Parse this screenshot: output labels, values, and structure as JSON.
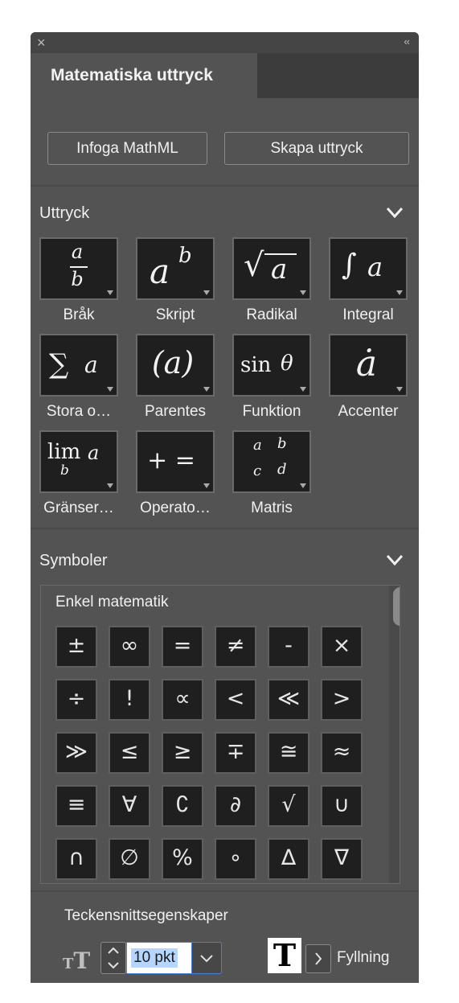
{
  "panel": {
    "close_icon": "×",
    "collapse_icon": "‹‹",
    "tab_title": "Matematiska uttryck"
  },
  "buttons": {
    "insert_mathml": "Infoga MathML",
    "create_expression": "Skapa uttryck"
  },
  "expressions": {
    "section_title": "Uttryck",
    "items": [
      {
        "label": "Bråk",
        "icon": "fraction-icon"
      },
      {
        "label": "Skript",
        "icon": "superscript-icon"
      },
      {
        "label": "Radikal",
        "icon": "radical-icon"
      },
      {
        "label": "Integral",
        "icon": "integral-icon"
      },
      {
        "label": "Stora o…",
        "icon": "large-operator-icon"
      },
      {
        "label": "Parentes",
        "icon": "parenthesis-icon"
      },
      {
        "label": "Funktion",
        "icon": "function-icon"
      },
      {
        "label": "Accenter",
        "icon": "accent-icon"
      },
      {
        "label": "Gränser…",
        "icon": "limit-icon"
      },
      {
        "label": "Operato…",
        "icon": "operator-icon"
      },
      {
        "label": "Matris",
        "icon": "matrix-icon"
      }
    ],
    "glyphs": {
      "frac_num": "a",
      "frac_den": "b",
      "script_base": "a",
      "script_sup": "b",
      "radical_sign": "√",
      "radical_arg": "a",
      "integral_sign": "∫",
      "integral_arg": "a",
      "sum_sign": "∑",
      "sum_arg": "a",
      "paren": "(a)",
      "func_name": "sin",
      "func_arg": "θ",
      "accent_base": "ȧ",
      "lim_name": "lim",
      "lim_arg": "a",
      "lim_sub": "b",
      "op_text": "+ =",
      "matrix": [
        "a",
        "b",
        "c",
        "d"
      ]
    }
  },
  "symbols": {
    "section_title": "Symboler",
    "group_title": "Enkel matematik",
    "grid": [
      [
        "±",
        "∞",
        "=",
        "≠",
        "-",
        "×"
      ],
      [
        "÷",
        "!",
        "∝",
        "<",
        "≪",
        ">"
      ],
      [
        "≫",
        "≤",
        "≥",
        "∓",
        "≅",
        "≈"
      ],
      [
        "≡",
        "∀",
        "∁",
        "∂",
        "√",
        "∪"
      ],
      [
        "∩",
        "∅",
        "%",
        "∘",
        "∆",
        "∇"
      ]
    ]
  },
  "font_properties": {
    "title": "Teckensnittsegenskaper",
    "size_value": "10 pkt",
    "fill_glyph": "T",
    "fill_label": "Fyllning"
  },
  "colors": {
    "panel_bg": "#535353",
    "tile_bg": "#1f1f1f",
    "field_focus": "#4a7fd6",
    "selection": "#b7d6ff"
  }
}
